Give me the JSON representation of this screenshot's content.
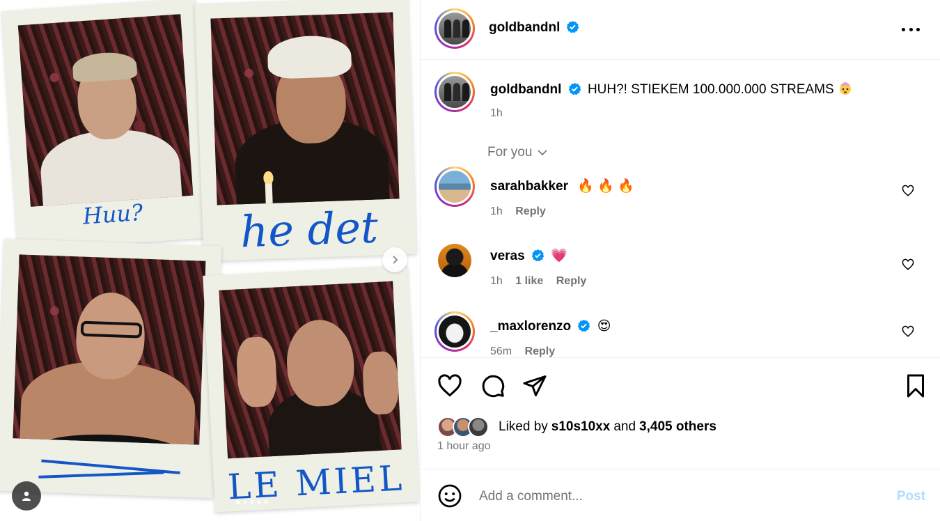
{
  "post": {
    "author": "goldbandnl",
    "caption": "HUH?! STIEKEM 100.000.000 STREAMS",
    "caption_emoji": "exploding-head-emoji",
    "caption_time": "1h"
  },
  "media": {
    "polaroid_captions": [
      "Huu?",
      "he det",
      "",
      "LE MIEL"
    ],
    "carousel_dots": 5,
    "active_dot": 0
  },
  "header": {
    "username": "goldbandnl",
    "more_label": "More options"
  },
  "filter": {
    "label": "For you"
  },
  "comments": [
    {
      "username": "sarahbakker",
      "text": "🔥 🔥 🔥",
      "time": "1h",
      "likes": "",
      "reply": "Reply",
      "verified": false,
      "story_ring": true
    },
    {
      "username": "veras",
      "text": "💗",
      "time": "1h",
      "likes": "1 like",
      "reply": "Reply",
      "verified": true,
      "story_ring": false
    },
    {
      "username": "_maxlorenzo",
      "text": "😍",
      "time": "56m",
      "likes": "",
      "reply": "Reply",
      "verified": true,
      "story_ring": true
    }
  ],
  "engagement": {
    "liked_prefix": "Liked by",
    "liked_user": "s10s10xx",
    "liked_and": "and",
    "liked_others": "3,405 others",
    "timestamp": "1 hour ago"
  },
  "composer": {
    "placeholder": "Add a comment...",
    "post_label": "Post"
  },
  "colors": {
    "verified": "#0095f6",
    "post_disabled": "#b3dbff",
    "muted": "#737373"
  }
}
